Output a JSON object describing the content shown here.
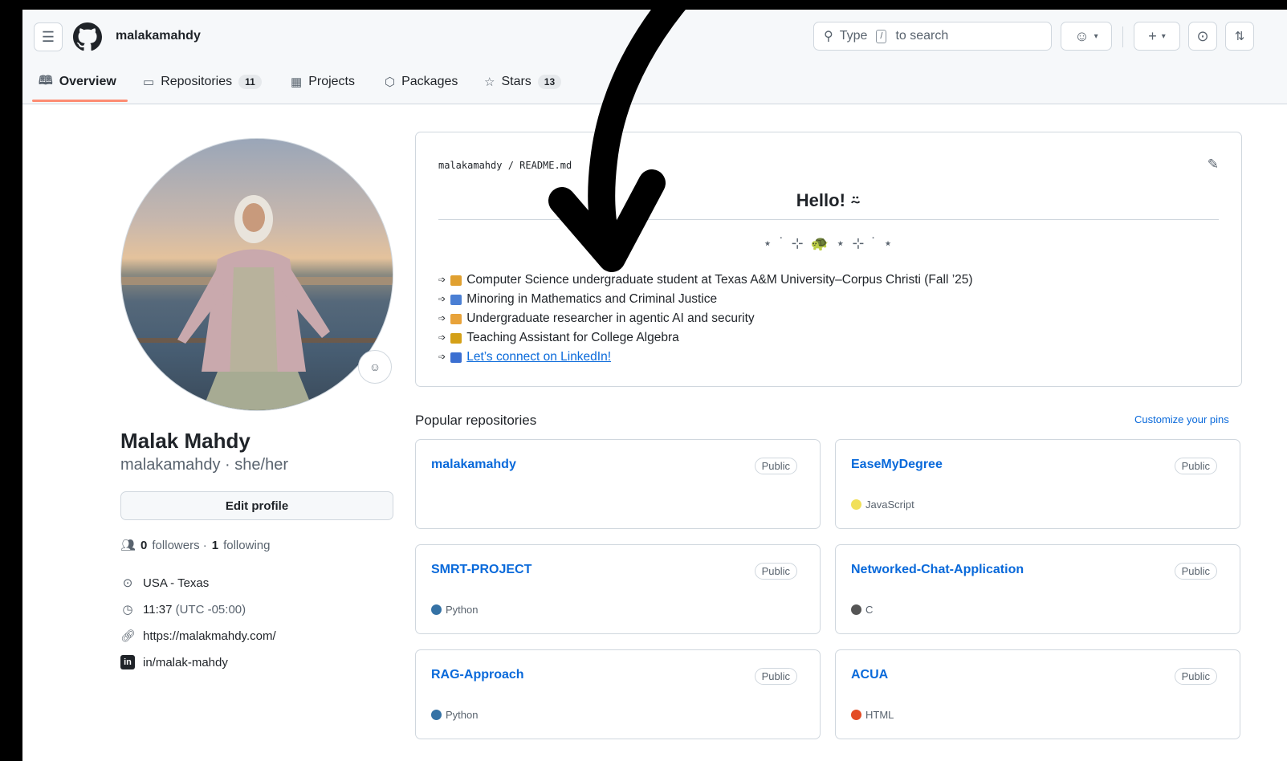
{
  "header": {
    "username": "malakamahdy",
    "search": {
      "prefix": "Type",
      "key": "/",
      "suffix": "to search"
    }
  },
  "nav": {
    "tabs": [
      {
        "label": "Overview"
      },
      {
        "label": "Repositories",
        "count": "11"
      },
      {
        "label": "Projects"
      },
      {
        "label": "Packages"
      },
      {
        "label": "Stars",
        "count": "13"
      }
    ]
  },
  "profile": {
    "full_name": "Malak Mahdy",
    "handle_line": "malakamahdy · she/her",
    "edit_label": "Edit profile",
    "followers_count": "0",
    "followers_label": "followers ·",
    "following_count": "1",
    "following_label": "following",
    "location": "USA - Texas",
    "time": "11:37",
    "timezone": "(UTC -05:00)",
    "website": "https://malakmahdy.com/",
    "linkedin": "in/malak-mahdy",
    "linkedin_badge": "in"
  },
  "readme": {
    "path": "malakamahdy / README.md",
    "title": "Hello! ⍨",
    "decoration": "⋆ ˙ ⊹ 🐢 ⋆ ⊹ ˙ ⋆",
    "items": [
      {
        "text": "Computer Science undergraduate student at Texas A&M University–Corpus Christi (Fall ’25)",
        "emoji_color": "#e0a030"
      },
      {
        "text": "Minoring in Mathematics and Criminal Justice",
        "emoji_color": "#4a7fd4"
      },
      {
        "text": "Undergraduate researcher in agentic AI and security",
        "emoji_color": "#e8a33a"
      },
      {
        "text": "Teaching Assistant for College Algebra",
        "emoji_color": "#d4a017"
      },
      {
        "text": "Let’s connect on LinkedIn!",
        "emoji_color": "#3b6fd1",
        "is_link": true
      }
    ]
  },
  "repos": {
    "title": "Popular repositories",
    "customize_label": "Customize your pins",
    "items": [
      {
        "name": "malakamahdy",
        "visibility": "Public",
        "language": "",
        "color": ""
      },
      {
        "name": "EaseMyDegree",
        "visibility": "Public",
        "language": "JavaScript",
        "color": "#f1e05a"
      },
      {
        "name": "SMRT-PROJECT",
        "visibility": "Public",
        "language": "Python",
        "color": "#3572A5"
      },
      {
        "name": "Networked-Chat-Application",
        "visibility": "Public",
        "language": "C",
        "color": "#555555"
      },
      {
        "name": "RAG-Approach",
        "visibility": "Public",
        "language": "Python",
        "color": "#3572A5"
      },
      {
        "name": "ACUA",
        "visibility": "Public",
        "language": "HTML",
        "color": "#e34c26"
      }
    ]
  },
  "colors": {
    "link": "#0969da",
    "tab_underline": "#fd8c73",
    "border": "#d0d7de"
  }
}
